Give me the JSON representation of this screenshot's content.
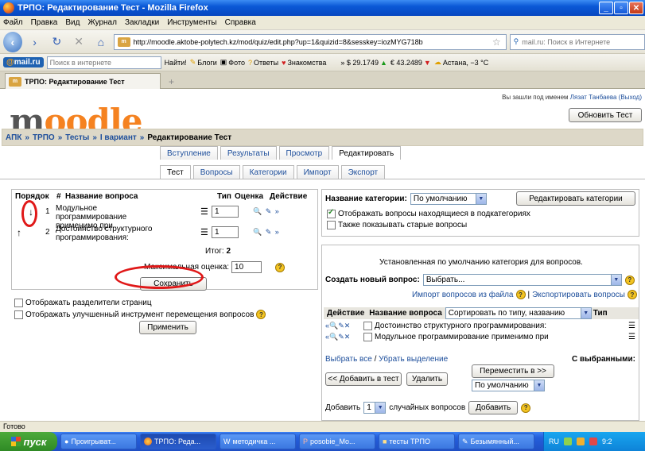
{
  "window": {
    "title": "ТРПО: Редактирование Тест - Mozilla Firefox",
    "min": "_",
    "max": "▫",
    "close": "✕"
  },
  "menu": [
    "Файл",
    "Правка",
    "Вид",
    "Журнал",
    "Закладки",
    "Инструменты",
    "Справка"
  ],
  "nav": {
    "url": "http://moodle.aktobe-polytech.kz/mod/quiz/edit.php?up=1&quizid=8&sesskey=iozMYG718b",
    "search_placeholder": "mail.ru: Поиск в Интернете",
    "favicon_text": "m"
  },
  "mailbar": {
    "logo_prefix": "@",
    "logo_text": "mail.ru",
    "search_placeholder": "Поиск в интернете",
    "find": "Найти!",
    "blogs": "Блоги",
    "photo": "Фото",
    "answers": "Ответы",
    "dating": "Знакомства",
    "usd": "» $ 29.1749",
    "eur": "€ 43.2489",
    "weather": "Астана, −3 °C"
  },
  "browser_tab": {
    "title": "ТРПО: Редактирование Тест",
    "new": "+"
  },
  "moodle": {
    "logo": "moodle",
    "logged_in_prefix": "Вы зашли под именем ",
    "user": "Лязат Танбаева",
    "logout": "(Выход)",
    "breadcrumb": [
      {
        "label": "АПК"
      },
      {
        "label": "ТРПО"
      },
      {
        "label": "Тесты"
      },
      {
        "label": "I вариант"
      }
    ],
    "breadcrumb_sep": "»",
    "breadcrumb_current": "Редактирование Тест",
    "update_button": "Обновить Тест",
    "tabs_row1": [
      "Вступление",
      "Результаты",
      "Просмотр",
      "Редактировать"
    ],
    "tabs_row2": [
      "Тест",
      "Вопросы",
      "Категории",
      "Импорт",
      "Экспорт"
    ],
    "questions_header": {
      "order": "Порядок",
      "num": "#",
      "name": "Название вопроса",
      "type": "Тип",
      "grade": "Оценка",
      "action": "Действие"
    },
    "questions": [
      {
        "arrow": "↓",
        "num": "1",
        "name": "Модульное программирование применимо при",
        "grade": "1",
        "type_icon": "☰",
        "actions": "🔍 ✎ »"
      },
      {
        "arrow": "↑",
        "num": "2",
        "name": "Достоинство структурного программирования:",
        "grade": "1",
        "type_icon": "☰",
        "actions": "🔍 ✎ »"
      }
    ],
    "total_label": "Итог:",
    "total_value": "2",
    "max_grade_label": "Максимальная оценка:",
    "max_grade_value": "10",
    "save_button": "Сохранить",
    "show_page_breaks": "Отображать разделители страниц",
    "show_reorder_tool": "Отображать улучшенный инструмент перемещения вопросов",
    "apply_button": "Применить",
    "help_glyph": "?",
    "category_label": "Название категории:",
    "category_value": "По умолчанию",
    "edit_categories_button": "Редактировать категории",
    "show_subcategories": "Отображать вопросы находящиеся в подкатегориях",
    "show_old": "Также показывать старые вопросы",
    "default_category_text": "Установленная по умолчанию категория для вопросов.",
    "create_label": "Создать новый вопрос:",
    "create_value": "Выбрать...",
    "import_link": "Импорт вопросов из файла",
    "link_sep": "|",
    "export_link": "Экспортировать вопросы",
    "bank_header": {
      "action": "Действие",
      "name": "Название вопроса",
      "sort_value": "Сортировать по типу, названию",
      "type": "Тип"
    },
    "bank_rows": [
      {
        "actions": "«🔍✎✕",
        "name": "Достоинство структурного программирования:",
        "type_icon": "☰"
      },
      {
        "actions": "«🔍✎✕",
        "name": "Модульное программирование применимо при",
        "type_icon": "☰"
      }
    ],
    "select_all": "Выбрать все",
    "select_slash": "/",
    "deselect": "Убрать выделение",
    "with_selected": "С выбранными:",
    "add_to_test_button": "<< Добавить в тест",
    "delete_button": "Удалить",
    "move_to_button": "Переместить в >>",
    "move_target_value": "По умолчанию",
    "add_label": "Добавить",
    "random_count": "1",
    "random_label": "случайных вопросов",
    "add_button": "Добавить"
  },
  "status": "Готово",
  "taskbar": {
    "start": "пуск",
    "items": [
      "Проигрыват...",
      "ТРПО: Реда...",
      "методичка ...",
      "posobie_Mo...",
      "тесты ТРПО",
      "Безымянный..."
    ],
    "lang": "RU",
    "clock": "9:2"
  },
  "colors": {
    "accent": "#f58220",
    "link": "#1d4e9b",
    "highlight_circle": "#e01818"
  }
}
